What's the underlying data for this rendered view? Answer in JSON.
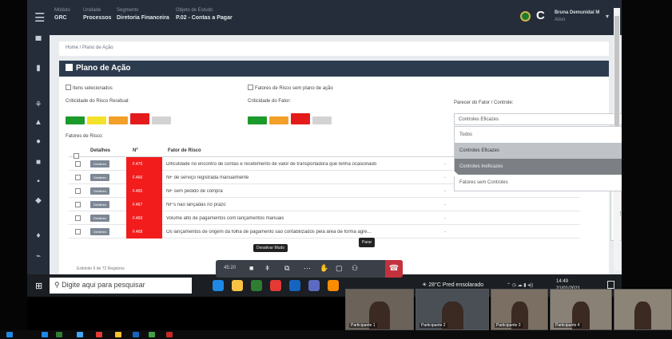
{
  "topbar": {
    "crumbs": [
      {
        "caption": "Módulo",
        "value": "GRC"
      },
      {
        "caption": "Unidade",
        "value": "Processos"
      },
      {
        "caption": "Segmento",
        "value": "Diretoria Financeira"
      },
      {
        "caption": "Objeto de Estudo",
        "value": "P.02 - Contas a Pagar"
      }
    ],
    "user_name": "Bruna Demunidal M",
    "user_role": "Ativo",
    "logo_letter": "C"
  },
  "breadcrumb": "Home / Plano de Ação",
  "panel": {
    "title": "Plano de Ação",
    "check_selected": "Itens selecionados",
    "check_no_plan": "Fatores de Risco sem plano de ação",
    "residual_label": "Criticidade do Risco Residual:",
    "factor_label": "Criticidade do Fator:",
    "control_label": "Parecer do Fator / Controle:",
    "factors_label": "Fatores de Risco:",
    "footnote": "Exibindo 6 de 72 Registros",
    "side_tab": "Filtros"
  },
  "select": {
    "value": "Controles Eficazes",
    "options": [
      "Todos",
      "Controles Eficazes",
      "Controles Ineficazes",
      "Fatores sem Controles"
    ]
  },
  "colors": {
    "green": "#1c9a2b",
    "yellow": "#f4e12b",
    "orange": "#f2a02a",
    "red": "#e51b1b",
    "gray": "#d3d3d3"
  },
  "table": {
    "headers": [
      "Detalhes",
      "Nº",
      "Fator de Risco"
    ],
    "details_label": "Detalhes",
    "rows": [
      {
        "num": "F.470",
        "risk": "Dificuldade no encontro de contas e recebimento de valor de transportadora que tenha ocasionado",
        "status": "-"
      },
      {
        "num": "F.466",
        "risk": "NF de serviço registrada manualmente",
        "status": "-"
      },
      {
        "num": "F.465",
        "risk": "NF sem pedido de compra",
        "status": "-"
      },
      {
        "num": "F.467",
        "risk": "NF's não lançadas no prazo",
        "status": "-"
      },
      {
        "num": "F.469",
        "risk": "Volume alto de pagamentos com lançamentos manuais",
        "status": "-"
      },
      {
        "num": "F.468",
        "risk": "Os lançamentos de origem da folha de pagamento são contabilizados pela área de forma agre...",
        "status": "-"
      }
    ]
  },
  "meeting": {
    "time": "45:20",
    "tip_share": "Desativar Mudo",
    "tip_raise": "Parar"
  },
  "taskbar": {
    "search_placeholder": "Digite aqui para pesquisar",
    "weather": "28°C Pred ensolarado",
    "lang": "POR PTB2",
    "time": "14:49",
    "date": "21/01/2021"
  },
  "video_tiles": [
    "Participante 1",
    "Participante 2",
    "Participante 3",
    "Participante 4"
  ]
}
